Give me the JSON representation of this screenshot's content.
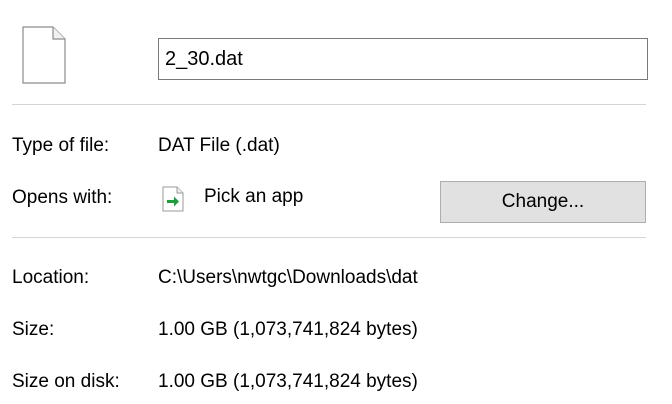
{
  "file": {
    "name": "2_30.dat",
    "icon": "blank-file-icon"
  },
  "type_row": {
    "label": "Type of file:",
    "value": "DAT File (.dat)"
  },
  "opens_with_row": {
    "label": "Opens with:",
    "app_icon": "pick-app-icon",
    "app_name": "Pick an app",
    "change_label": "Change..."
  },
  "location_row": {
    "label": "Location:",
    "value": "C:\\Users\\nwtgc\\Downloads\\dat"
  },
  "size_row": {
    "label": "Size:",
    "value": "1.00 GB (1,073,741,824 bytes)"
  },
  "size_on_disk_row": {
    "label": "Size on disk:",
    "value": "1.00 GB (1,073,741,824 bytes)"
  },
  "colors": {
    "button_bg": "#e1e1e1",
    "divider": "#d5d5d5",
    "app_icon_arrow": "#1e9e3a"
  }
}
